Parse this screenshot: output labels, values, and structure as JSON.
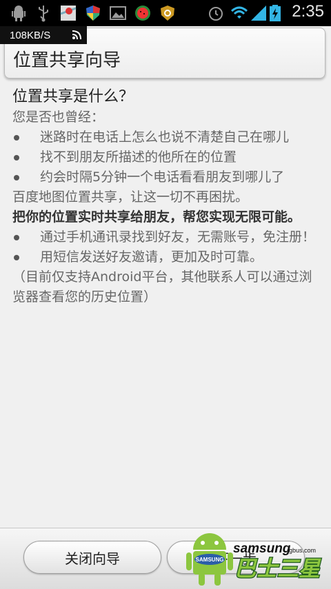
{
  "status_bar": {
    "time": "2:35",
    "icons": [
      "android-debug-icon",
      "usb-icon",
      "maps-icon",
      "shield-icon",
      "gallery-icon",
      "watermelon-icon",
      "security-icon",
      "alarm-icon",
      "wifi-icon",
      "signal-icon",
      "battery-charging-icon"
    ]
  },
  "speed_overlay": {
    "text": "108KB/S"
  },
  "title": "位置共享向导",
  "content": {
    "heading": "位置共享是什么？",
    "intro": "您是否也曾经：",
    "bullets1": [
      "迷路时在电话上怎么也说不清楚自己在哪儿",
      "找不到朋友所描述的他所在的位置",
      "约会时隔5分钟一个电话看看朋友到哪儿了"
    ],
    "summary": "百度地图位置共享，让这一切不再困扰。",
    "highlight": "把你的位置实时共享给朋友，帮您实现无限可能。",
    "bullets2": [
      "通过手机通讯录找到好友，无需账号，免注册！",
      "用短信发送好友邀请，更加及时可靠。"
    ],
    "note": "（目前仅支持Android平台，其他联系人可以通过浏览器查看您的历史位置）"
  },
  "buttons": {
    "close": "关闭向导",
    "next": "下一步"
  },
  "watermark": {
    "brand": "samsung",
    "domain": ".tgbus.com",
    "cn": "巴士三星",
    "robot_label": "SAMSUNG"
  }
}
